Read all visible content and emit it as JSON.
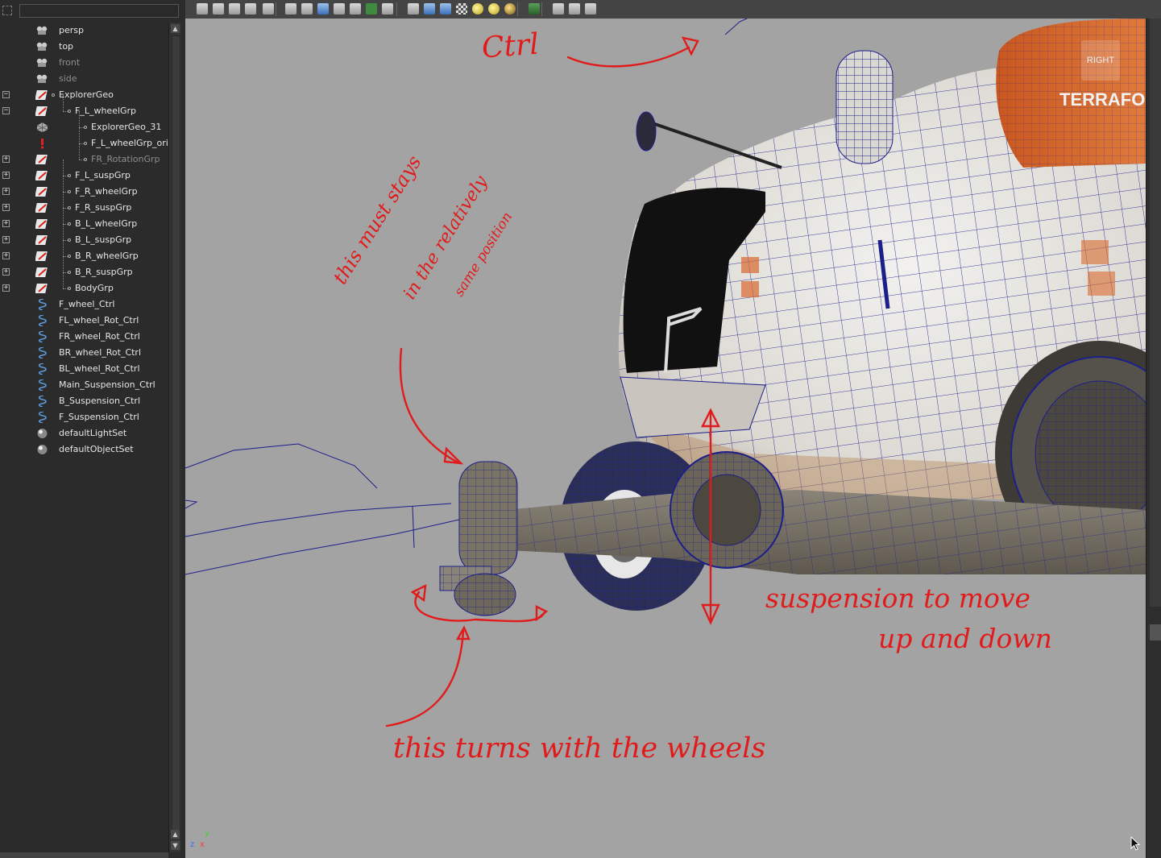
{
  "outliner": {
    "search_value": "",
    "items": [
      {
        "label": "persp",
        "icon": "camera-icon",
        "dim": false,
        "indent": 0,
        "expander": "",
        "tree": false
      },
      {
        "label": "top",
        "icon": "camera-icon",
        "dim": false,
        "indent": 0,
        "expander": "",
        "tree": false
      },
      {
        "label": "front",
        "icon": "camera-icon",
        "dim": true,
        "indent": 0,
        "expander": "",
        "tree": false
      },
      {
        "label": "side",
        "icon": "camera-icon",
        "dim": true,
        "indent": 0,
        "expander": "",
        "tree": false
      },
      {
        "label": "ExplorerGeo",
        "icon": "group-transform-icon",
        "dim": false,
        "indent": 0,
        "expander": "−",
        "tree": false
      },
      {
        "label": "F_L_wheelGrp",
        "icon": "group-transform-icon",
        "dim": false,
        "indent": 1,
        "expander": "−",
        "tree": true
      },
      {
        "label": "ExplorerGeo_31",
        "icon": "mesh-icon",
        "dim": false,
        "indent": 2,
        "expander": "",
        "tree": true
      },
      {
        "label": "F_L_wheelGrp_orie",
        "icon": "warning-icon",
        "dim": false,
        "indent": 2,
        "expander": "",
        "tree": true
      },
      {
        "label": "FR_RotationGrp",
        "icon": "group-transform-icon",
        "dim": true,
        "indent": 2,
        "expander": "+",
        "tree": true
      },
      {
        "label": "F_L_suspGrp",
        "icon": "group-transform-icon",
        "dim": false,
        "indent": 1,
        "expander": "+",
        "tree": true
      },
      {
        "label": "F_R_wheelGrp",
        "icon": "group-transform-icon",
        "dim": false,
        "indent": 1,
        "expander": "+",
        "tree": true
      },
      {
        "label": "F_R_suspGrp",
        "icon": "group-transform-icon",
        "dim": false,
        "indent": 1,
        "expander": "+",
        "tree": true
      },
      {
        "label": "B_L_wheelGrp",
        "icon": "group-transform-icon",
        "dim": false,
        "indent": 1,
        "expander": "+",
        "tree": true
      },
      {
        "label": "B_L_suspGrp",
        "icon": "group-transform-icon",
        "dim": false,
        "indent": 1,
        "expander": "+",
        "tree": true
      },
      {
        "label": "B_R_wheelGrp",
        "icon": "group-transform-icon",
        "dim": false,
        "indent": 1,
        "expander": "+",
        "tree": true
      },
      {
        "label": "B_R_suspGrp",
        "icon": "group-transform-icon",
        "dim": false,
        "indent": 1,
        "expander": "+",
        "tree": true
      },
      {
        "label": "BodyGrp",
        "icon": "group-transform-icon",
        "dim": false,
        "indent": 1,
        "expander": "+",
        "tree": true
      },
      {
        "label": "F_wheel_Ctrl",
        "icon": "curve-icon",
        "dim": false,
        "indent": 0,
        "expander": "",
        "tree": false
      },
      {
        "label": "FL_wheel_Rot_Ctrl",
        "icon": "curve-icon",
        "dim": false,
        "indent": 0,
        "expander": "",
        "tree": false
      },
      {
        "label": "FR_wheel_Rot_Ctrl",
        "icon": "curve-icon",
        "dim": false,
        "indent": 0,
        "expander": "",
        "tree": false
      },
      {
        "label": "BR_wheel_Rot_Ctrl",
        "icon": "curve-icon",
        "dim": false,
        "indent": 0,
        "expander": "",
        "tree": false
      },
      {
        "label": "BL_wheel_Rot_Ctrl",
        "icon": "curve-icon",
        "dim": false,
        "indent": 0,
        "expander": "",
        "tree": false
      },
      {
        "label": "Main_Suspension_Ctrl",
        "icon": "curve-icon",
        "dim": false,
        "indent": 0,
        "expander": "",
        "tree": false
      },
      {
        "label": "B_Suspension_Ctrl",
        "icon": "curve-icon",
        "dim": false,
        "indent": 0,
        "expander": "",
        "tree": false
      },
      {
        "label": "F_Suspension_Ctrl",
        "icon": "curve-icon",
        "dim": false,
        "indent": 0,
        "expander": "",
        "tree": false
      },
      {
        "label": "defaultLightSet",
        "icon": "set-icon",
        "dim": false,
        "indent": 0,
        "expander": "",
        "tree": false
      },
      {
        "label": "defaultObjectSet",
        "icon": "set-icon",
        "dim": false,
        "indent": 0,
        "expander": "",
        "tree": false
      }
    ]
  },
  "toolbar": {
    "icons": [
      "camera-attributes-icon",
      "select-camera-icon",
      "film-gate-icon",
      "bookmark-icon",
      "image-plane-icon",
      "wireframe-icon",
      "grid-icon",
      "smooth-shade-icon",
      "flat-shade-icon",
      "xray-icon",
      "texture-icon",
      "text-icon",
      "bounding-box-icon",
      "shaded-icon",
      "wireframe-on-shaded-icon",
      "checker-icon",
      "default-light-icon",
      "all-lights-icon",
      "shadow-icon",
      "isolate-select-icon",
      "resolution-gate-icon",
      "safe-frame-icon",
      "node-editor-icon"
    ]
  },
  "viewport": {
    "view_label": "RIGHT",
    "decal_text": "TERRAFO",
    "axis_x": "z",
    "axis_y": "y",
    "axis_z": "x",
    "colors": {
      "background": "#a3a3a3",
      "annotation": "#e11b1b",
      "wire": "#1c1f8a",
      "hull": "#e6e4e0",
      "accent": "#d86a2f"
    }
  },
  "annotations": {
    "ctrl": "Ctrl",
    "stays_line1": "this must stays",
    "stays_line2": "in the relatively",
    "stays_line3": "same position",
    "suspension_line1": "suspension to move",
    "suspension_line2": "up and down",
    "turns": "this turns with the wheels"
  }
}
